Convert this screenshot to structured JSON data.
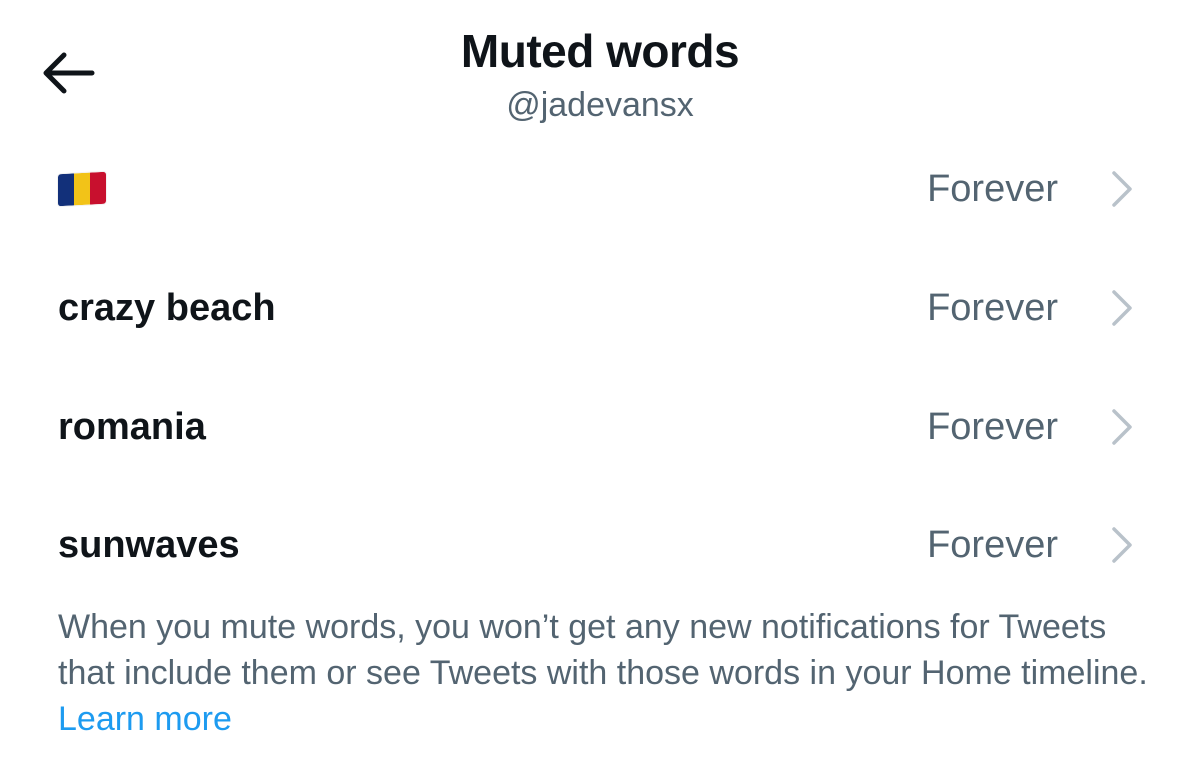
{
  "header": {
    "title": "Muted words",
    "username": "@jadevansx"
  },
  "muted_words": [
    {
      "word": "",
      "is_emoji_flag": true,
      "flag_colors": [
        "#12307a",
        "#f2c318",
        "#c8102e"
      ],
      "duration": "Forever"
    },
    {
      "word": "crazy beach",
      "is_emoji_flag": false,
      "duration": "Forever"
    },
    {
      "word": "romania",
      "is_emoji_flag": false,
      "duration": "Forever"
    },
    {
      "word": "sunwaves",
      "is_emoji_flag": false,
      "duration": "Forever"
    }
  ],
  "info": {
    "text": "When you mute words, you won’t get any new notifications for Tweets that include them or see Tweets with those words in your Home timeline.",
    "link_label": "Learn more"
  },
  "colors": {
    "primary_text": "#0f1419",
    "secondary_text": "#536471",
    "chevron": "#b9c2ca",
    "link": "#1d9bf0"
  },
  "icons": {
    "back": "arrow-left-icon",
    "row_chevron": "chevron-right-icon"
  }
}
